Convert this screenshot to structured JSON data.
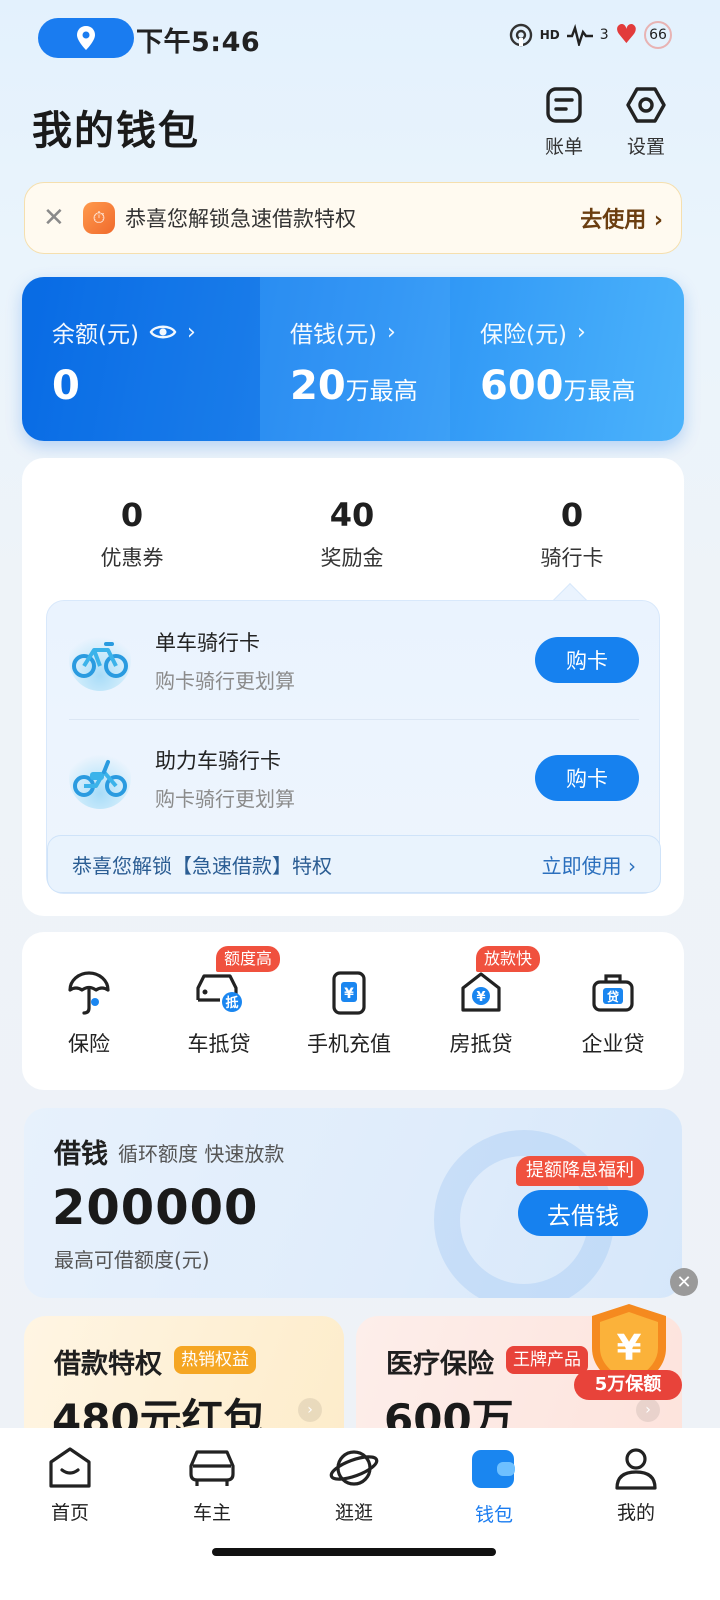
{
  "status": {
    "time": "下午5:46",
    "indicator": "HD",
    "signal": "3",
    "battery": "66"
  },
  "header": {
    "title": "我的钱包",
    "bill_label": "账单",
    "settings_label": "设置"
  },
  "notice": {
    "text": "恭喜您解锁急速借款特权",
    "cta": "去使用"
  },
  "balance_card": {
    "balance_label": "余额(元)",
    "balance_value": "0",
    "borrow_label": "借钱(元)",
    "borrow_value": "20",
    "borrow_suffix": "万最高",
    "insurance_label": "保险(元)",
    "insurance_value": "600",
    "insurance_suffix": "万最高"
  },
  "stats": [
    {
      "num": "0",
      "label": "优惠券"
    },
    {
      "num": "40",
      "label": "奖励金"
    },
    {
      "num": "0",
      "label": "骑行卡"
    }
  ],
  "ride_cards": [
    {
      "title": "单车骑行卡",
      "subtitle": "购卡骑行更划算",
      "button": "购卡"
    },
    {
      "title": "助力车骑行卡",
      "subtitle": "购卡骑行更划算",
      "button": "购卡"
    }
  ],
  "ride_footer": {
    "text": "恭喜您解锁【急速借款】特权",
    "cta": "立即使用"
  },
  "services": [
    {
      "label": "保险",
      "badge": ""
    },
    {
      "label": "车抵贷",
      "badge": "额度高"
    },
    {
      "label": "手机充值",
      "badge": ""
    },
    {
      "label": "房抵贷",
      "badge": "放款快"
    },
    {
      "label": "企业贷",
      "badge": ""
    }
  ],
  "loan": {
    "title": "借钱",
    "subtitle": "循环额度 快速放款",
    "amount": "200000",
    "caption": "最高可借额度(元)",
    "button": "去借钱",
    "badge": "提额降息福利"
  },
  "promos": [
    {
      "title": "借款特权",
      "tag": "热销权益",
      "big": "480元红包"
    },
    {
      "title": "医疗保险",
      "tag": "王牌产品",
      "big": "600万"
    }
  ],
  "shield_badge": "5万保额",
  "icon_glyphs": {
    "car_mortgage": "抵",
    "phone_recharge": "¥",
    "house_mortgage": "¥",
    "business_loan": "贷",
    "shield": "¥"
  },
  "tabs": [
    {
      "label": "首页"
    },
    {
      "label": "车主"
    },
    {
      "label": "逛逛"
    },
    {
      "label": "钱包"
    },
    {
      "label": "我的"
    }
  ],
  "colors": {
    "accent": "#1a7cf0",
    "badge_red": "#f0513e",
    "gold_cta": "#6b3e10"
  }
}
